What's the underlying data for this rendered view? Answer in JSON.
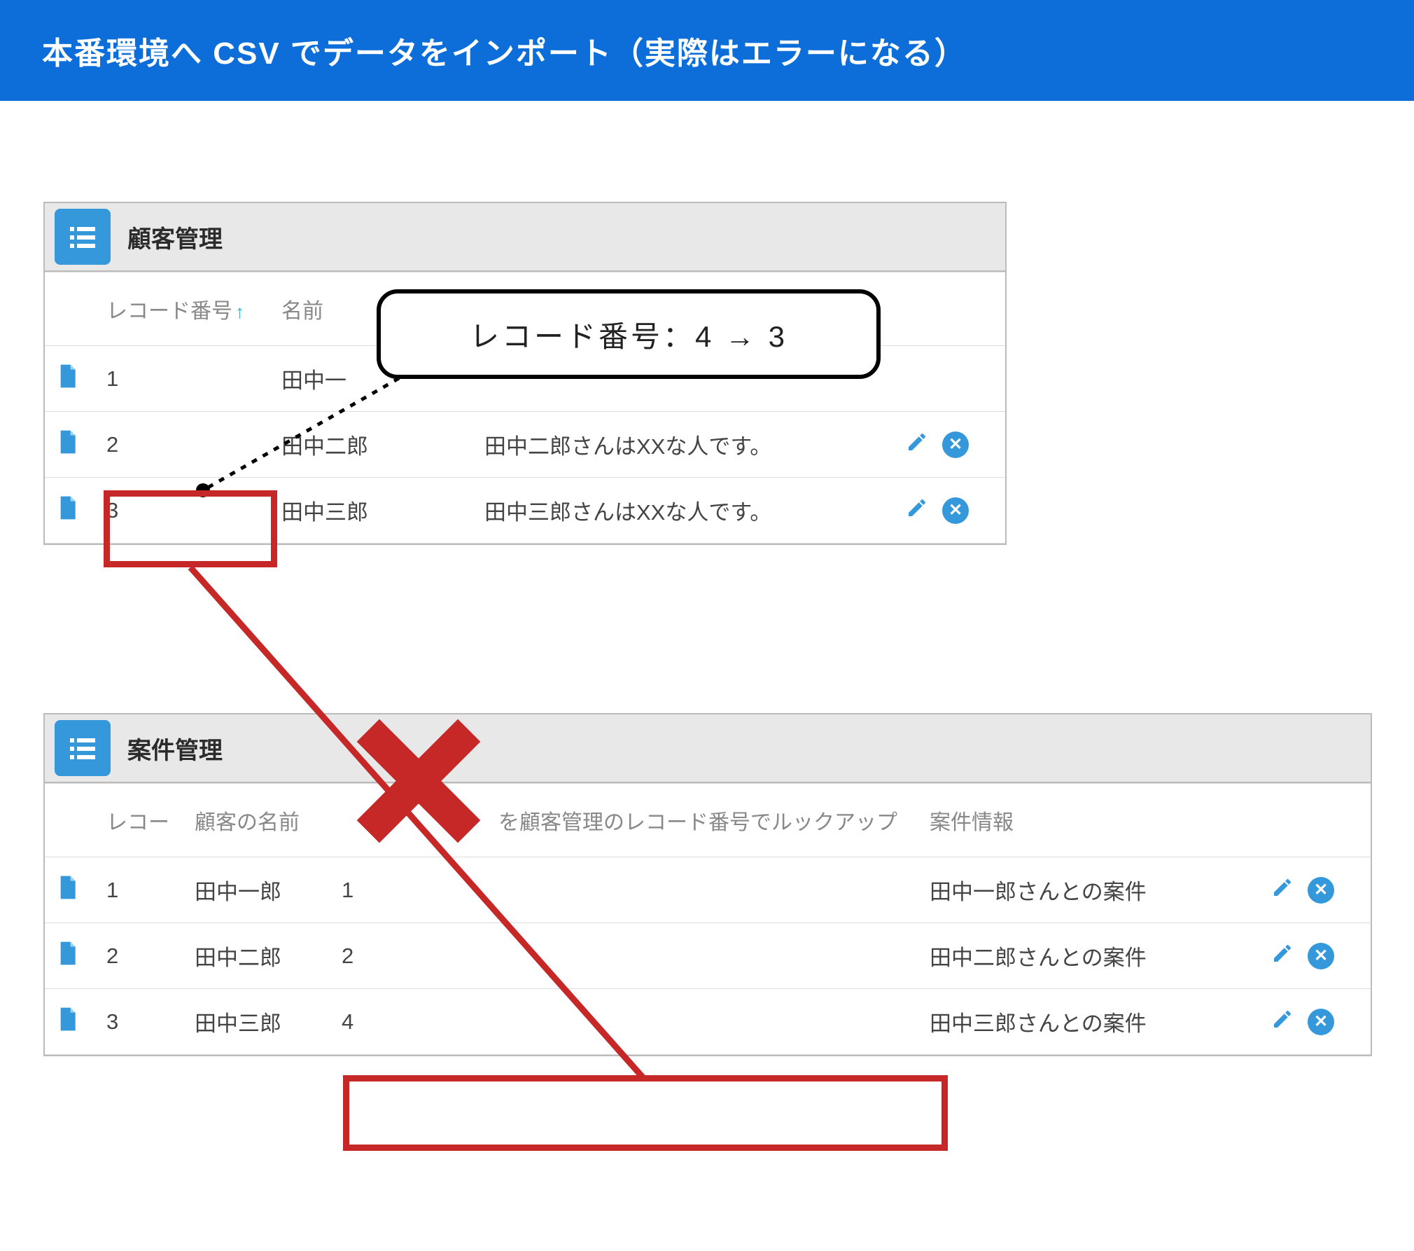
{
  "title": "本番環境へ CSV でデータをインポート（実際はエラーになる）",
  "callout": "レコード番号：4 → 3",
  "panel1": {
    "title": "顧客管理",
    "columns": {
      "record_no": "レコード番号",
      "name": "名前"
    },
    "rows": [
      {
        "no": "1",
        "name": "田中一",
        "desc": ""
      },
      {
        "no": "2",
        "name": "田中二郎",
        "desc": "田中二郎さんはXXな人です。"
      },
      {
        "no": "3",
        "name": "田中三郎",
        "desc": "田中三郎さんはXXな人です。"
      }
    ]
  },
  "panel2": {
    "title": "案件管理",
    "columns": {
      "record_short": "レコー",
      "customer_name": "顧客の名前",
      "lookup": "を顧客管理のレコード番号でルックアップ",
      "case_info": "案件情報"
    },
    "rows": [
      {
        "no": "1",
        "name": "田中一郎",
        "lookup": "1",
        "case": "田中一郎さんとの案件"
      },
      {
        "no": "2",
        "name": "田中二郎",
        "lookup": "2",
        "case": "田中二郎さんとの案件"
      },
      {
        "no": "3",
        "name": "田中三郎",
        "lookup": "4",
        "case": "田中三郎さんとの案件"
      }
    ]
  },
  "colors": {
    "accent": "#3498db",
    "title_bg": "#0d6ed9",
    "error": "#c62828"
  }
}
